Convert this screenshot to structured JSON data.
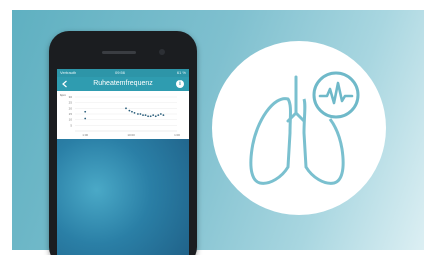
{
  "status_bar": {
    "carrier": "Vertrauth",
    "time": "09:56",
    "battery": "61 %"
  },
  "app_bar": {
    "title": "Ruheatemfrequenz",
    "info_label": "i"
  },
  "chart_data": {
    "type": "scatter",
    "ylabel": "bpm",
    "ytick_labels": [
      "30",
      "25",
      "20",
      "15",
      "10",
      "5"
    ],
    "xtick_labels": [
      "1:00",
      "10:00",
      "1:00"
    ],
    "series": [
      {
        "values": [
          [
            0.6,
            17
          ],
          [
            0.6,
            11
          ]
        ]
      },
      {
        "values": [
          [
            3.0,
            20
          ],
          [
            3.2,
            18
          ],
          [
            3.35,
            17
          ],
          [
            3.5,
            16
          ],
          [
            3.7,
            15
          ],
          [
            3.85,
            15
          ],
          [
            4.0,
            14
          ],
          [
            4.15,
            14
          ],
          [
            4.3,
            13
          ],
          [
            4.45,
            13
          ],
          [
            4.6,
            14
          ],
          [
            4.75,
            13
          ],
          [
            4.9,
            14
          ],
          [
            5.05,
            15
          ],
          [
            5.2,
            14
          ]
        ]
      }
    ],
    "color": "#2b5f7c",
    "xlim": [
      0,
      6
    ],
    "ylim": [
      0,
      30
    ]
  },
  "colors": {
    "accent": "#2f9cb0",
    "badge_icon": "#6fb9c9"
  },
  "icons": [
    "back-arrow-icon",
    "info-icon",
    "lungs-icon",
    "heartbeat-icon"
  ]
}
